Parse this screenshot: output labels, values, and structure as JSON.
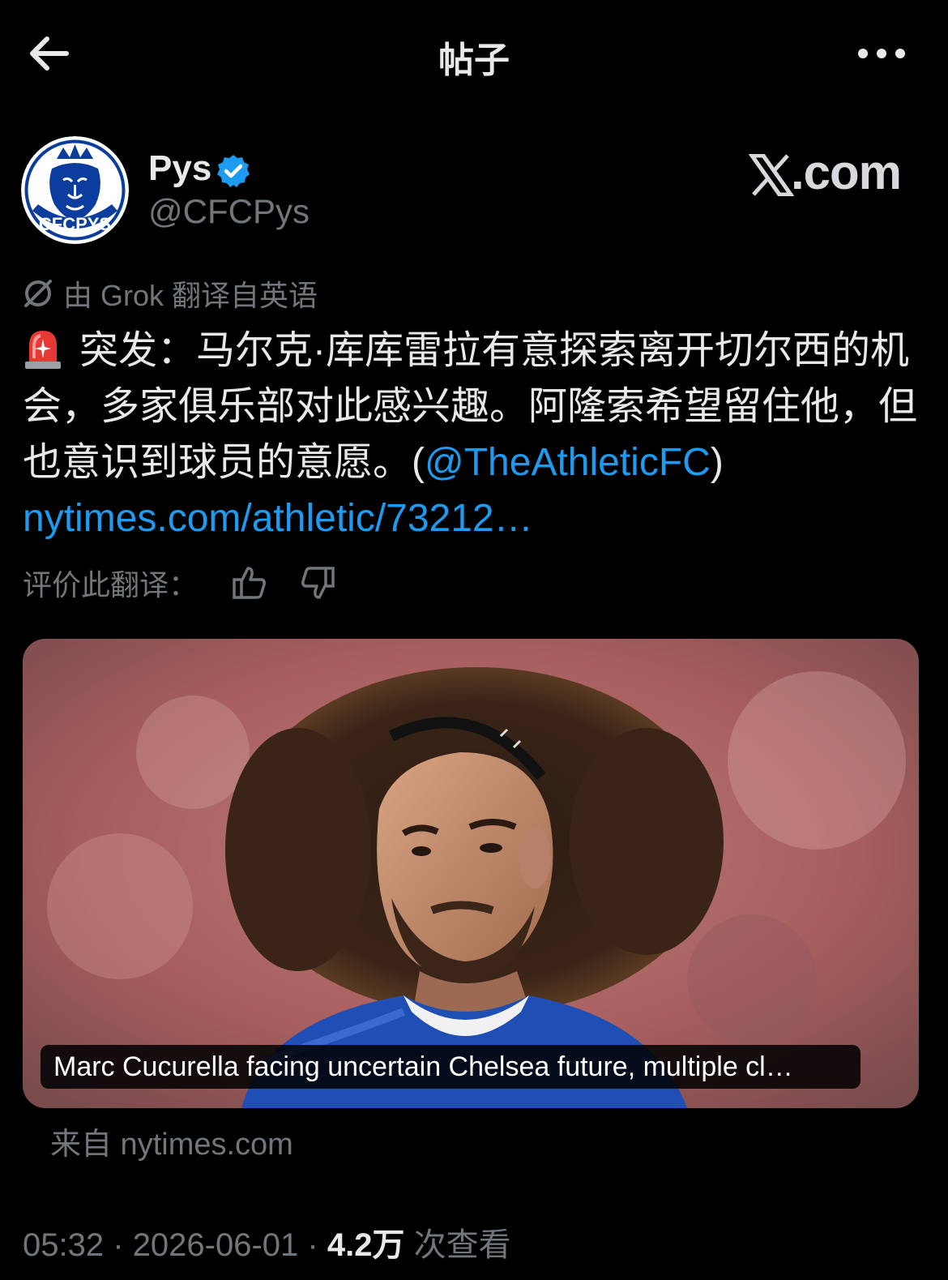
{
  "header": {
    "title": "帖子"
  },
  "author": {
    "display_name": "Pys",
    "handle": "@CFCPys",
    "avatar_text": "CFCPYS"
  },
  "brand": {
    "label": "X.com",
    "suffix": ".com"
  },
  "translation": {
    "notice": "由 Grok 翻译自英语",
    "rate_label": "评价此翻译："
  },
  "tweet": {
    "text_main": "突发：马尔克·库库雷拉有意探索离开切尔西的机会，多家俱乐部对此感兴趣。阿隆索希望留住他，但也意识到球员的意愿。(",
    "mention": "@TheAthleticFC",
    "text_close": ")",
    "url": "nytimes.com/athletic/73212…"
  },
  "card": {
    "caption": "Marc Cucurella facing uncertain Chelsea future, multiple cl…",
    "source": "来自 nytimes.com"
  },
  "meta": {
    "time": "05:32",
    "date": "2026-06-01",
    "views_count": "4.2万",
    "views_label": "次查看",
    "sep": "·"
  },
  "colors": {
    "background": "#000000",
    "link": "#1d9bf0",
    "muted": "#71767b",
    "verified": "#1d9bf0"
  }
}
